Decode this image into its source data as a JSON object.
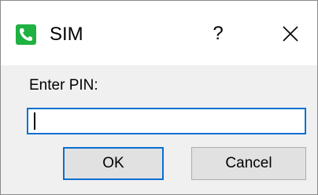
{
  "window": {
    "title": "SIM",
    "app_icon": "phone-icon",
    "help_label": "?",
    "close_icon": "close-icon"
  },
  "form": {
    "pin_label": "Enter PIN:",
    "pin_value": "",
    "pin_placeholder": ""
  },
  "buttons": {
    "ok_label": "OK",
    "cancel_label": "Cancel"
  },
  "colors": {
    "accent": "#0a6fd2",
    "icon_green": "#1fb141"
  }
}
